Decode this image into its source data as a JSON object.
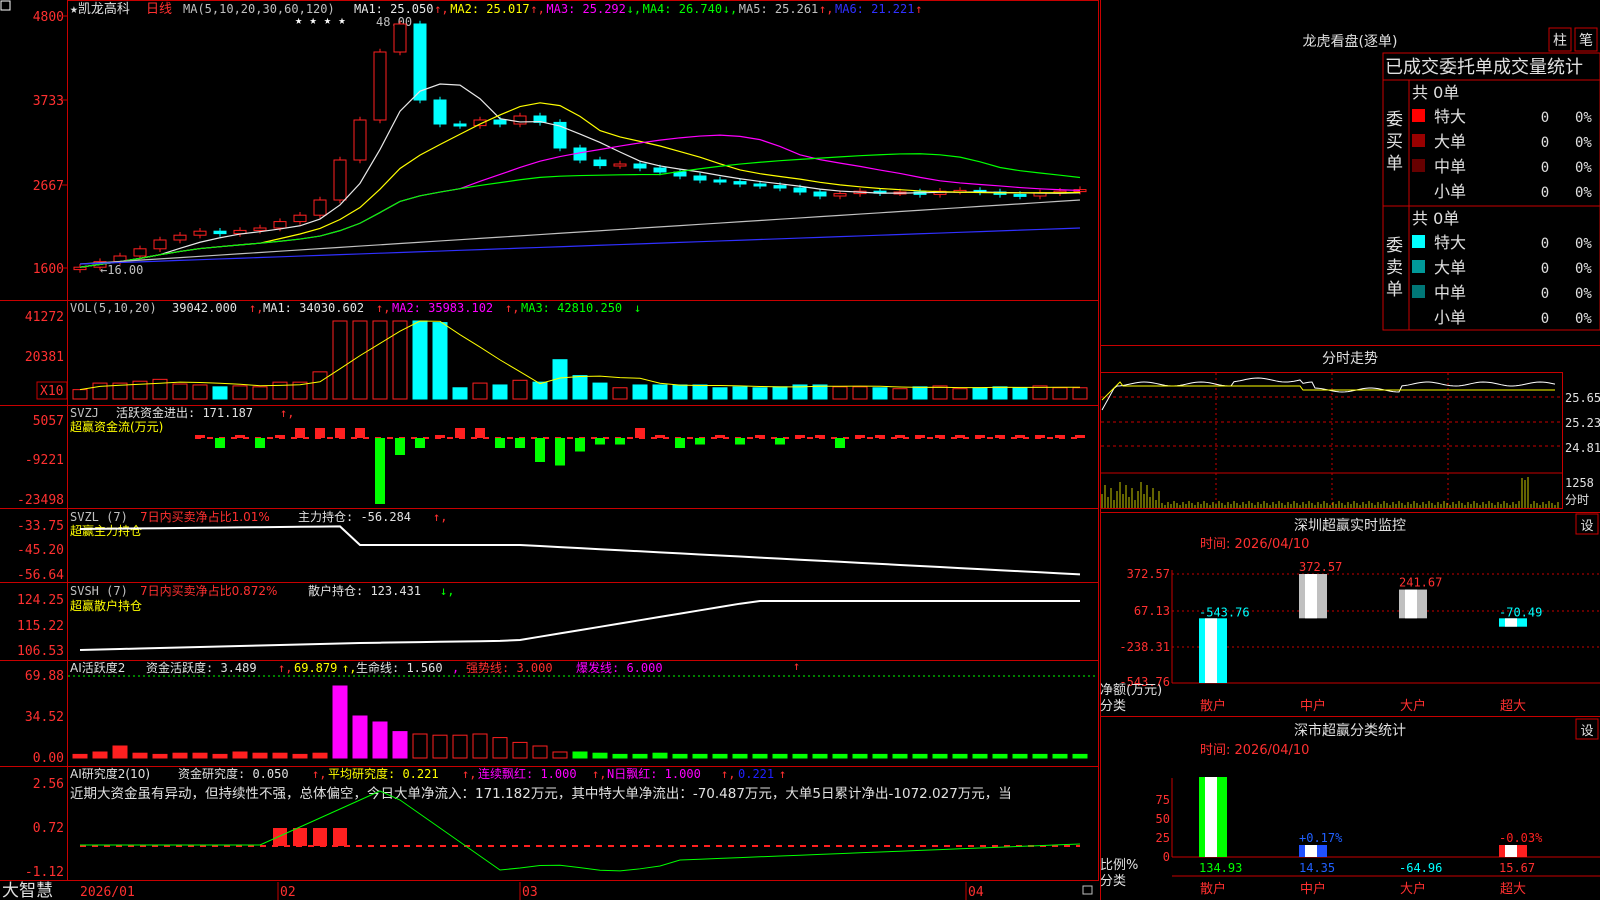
{
  "colors": {
    "up": "#ff2020",
    "down": "#00ffff",
    "axis": "#c80000",
    "white": "#e0e0e0",
    "yellow": "#ffff00",
    "magenta": "#ff00ff",
    "green": "#00ff00",
    "blue": "#2020ff"
  },
  "main": {
    "title": "★凯龙高科",
    "period": "日线",
    "ma_params": "MA(5,10,20,30,60,120)",
    "ma_values": [
      {
        "label": "MA1: 25.050",
        "arrow": "↑",
        "color": "#e8e8e8"
      },
      {
        "label": "MA2: 25.017",
        "arrow": "↑",
        "color": "#ffff00"
      },
      {
        "label": "MA3: 25.292",
        "arrow": "↓",
        "color": "#ff00ff"
      },
      {
        "label": "MA4: 26.740",
        "arrow": "↓",
        "color": "#00ff00"
      },
      {
        "label": "MA5: 25.261",
        "arrow": "↑",
        "color": "#c0c0c0"
      },
      {
        "label": "MA6: 21.221",
        "arrow": "↑",
        "color": "#3030ff"
      }
    ],
    "price_ticks": [
      "4800",
      "3733",
      "2667",
      "1600"
    ],
    "high_mark": "48.00",
    "low_mark": "←16.00",
    "stars": "★ ★ ★ ★"
  },
  "vol": {
    "label": "VOL(5,10,20)",
    "value": "39042.000",
    "ma1": "MA1: 34030.602",
    "ma2": "MA2: 35983.102",
    "ma3": "MA3: 42810.250",
    "ticks": [
      "41272",
      "20381"
    ],
    "unit": "X10"
  },
  "svzj": {
    "label": "SVZJ",
    "line": "活跃资金进出: 171.187",
    "sub": "超赢资金流(万元)",
    "ticks": [
      "5057",
      "-9221",
      "-23498"
    ]
  },
  "svzl": {
    "label": "SVZL (7)",
    "pct": "7日内买卖净占比1.01%",
    "line": "主力持仓: -56.284",
    "sub": "超赢主力持仓",
    "ticks": [
      "-33.75",
      "-45.20",
      "-56.64"
    ]
  },
  "svsh": {
    "label": "SVSH (7)",
    "pct": "7日内买卖净占比0.872%",
    "line": "散户持仓: 123.431",
    "sub": "超赢散户持仓",
    "ticks": [
      "124.25",
      "115.22",
      "106.53"
    ]
  },
  "ai1": {
    "label": "AI活跃度2",
    "a": "资金活跃度: 3.489",
    "b": "69.879",
    "c": "生命线: 1.560",
    "d": "强势线: 3.000",
    "e": "爆发线: 6.000",
    "ticks": [
      "69.88",
      "34.52",
      "0.00"
    ]
  },
  "ai2": {
    "label": "AI研究度2(10)",
    "a": "资金研究度: 0.050",
    "b": "平均研究度: 0.221",
    "c": "连续飘红: 1.000",
    "d": "N日飘红: 1.000",
    "e": "0.221",
    "comment": "近期大资金虽有异动，但持续性不强，总体偏空，今日大单净流入：171.182万元，其中特大单净流出：-70.487万元，大单5日累计净出-1072.027万元，当",
    "ticks": [
      "2.56",
      "0.72",
      "-1.12"
    ]
  },
  "dates": [
    "2026/01",
    "02",
    "03",
    "04"
  ],
  "brand": "大智慧",
  "lhkp": {
    "title": "龙虎看盘(逐单)",
    "btn1": "柱",
    "btn2": "笔",
    "header": "已成交委托单成交量统计",
    "buy_side": "委买单",
    "sell_side": "委卖单",
    "total": "共 0单",
    "rows": [
      {
        "name": "特大",
        "v": "0",
        "p": "0%"
      },
      {
        "name": "大单",
        "v": "0",
        "p": "0%"
      },
      {
        "name": "中单",
        "v": "0",
        "p": "0%"
      },
      {
        "name": "小单",
        "v": "0",
        "p": "0%"
      }
    ],
    "buy_colors": [
      "#ff0000",
      "#990000",
      "#660000",
      "#000000"
    ],
    "sell_colors": [
      "#00ffff",
      "#009999",
      "#007777",
      "#000000"
    ]
  },
  "fenshi": {
    "title": "分时走势",
    "ticks": [
      "25.65",
      "25.23",
      "24.81"
    ],
    "vol": "1258",
    "unit": "分时"
  },
  "szjk": {
    "title": "深圳超赢实时监控",
    "btn": "设",
    "time": "时间: 2026/04/10",
    "ticks": [
      "372.57",
      "67.13",
      "-238.31",
      "-543.76"
    ],
    "ylabel": "净额(万元)",
    "xlabel": "分类",
    "bars": [
      {
        "cat": "散户",
        "v": -543.76,
        "label": "-543.76"
      },
      {
        "cat": "中户",
        "v": 372.57,
        "label": "372.57"
      },
      {
        "cat": "大户",
        "v": 241.67,
        "label": "241.67"
      },
      {
        "cat": "超大",
        "v": -70.49,
        "label": "-70.49"
      }
    ]
  },
  "szfl": {
    "title": "深市超赢分类统计",
    "btn": "设",
    "time": "时间: 2026/04/10",
    "ticks": [
      "75",
      "50",
      "25",
      "0"
    ],
    "ylabel": "比例%",
    "xlabel": "分类",
    "cats": [
      "散户",
      "中户",
      "大户",
      "超大"
    ],
    "vals": [
      "134.93",
      "14.35",
      "-64.96",
      "15.67"
    ],
    "labels": [
      "",
      "+0.17%",
      "",
      "-0.03%"
    ],
    "pcts": [
      80,
      12,
      0,
      12
    ]
  }
}
